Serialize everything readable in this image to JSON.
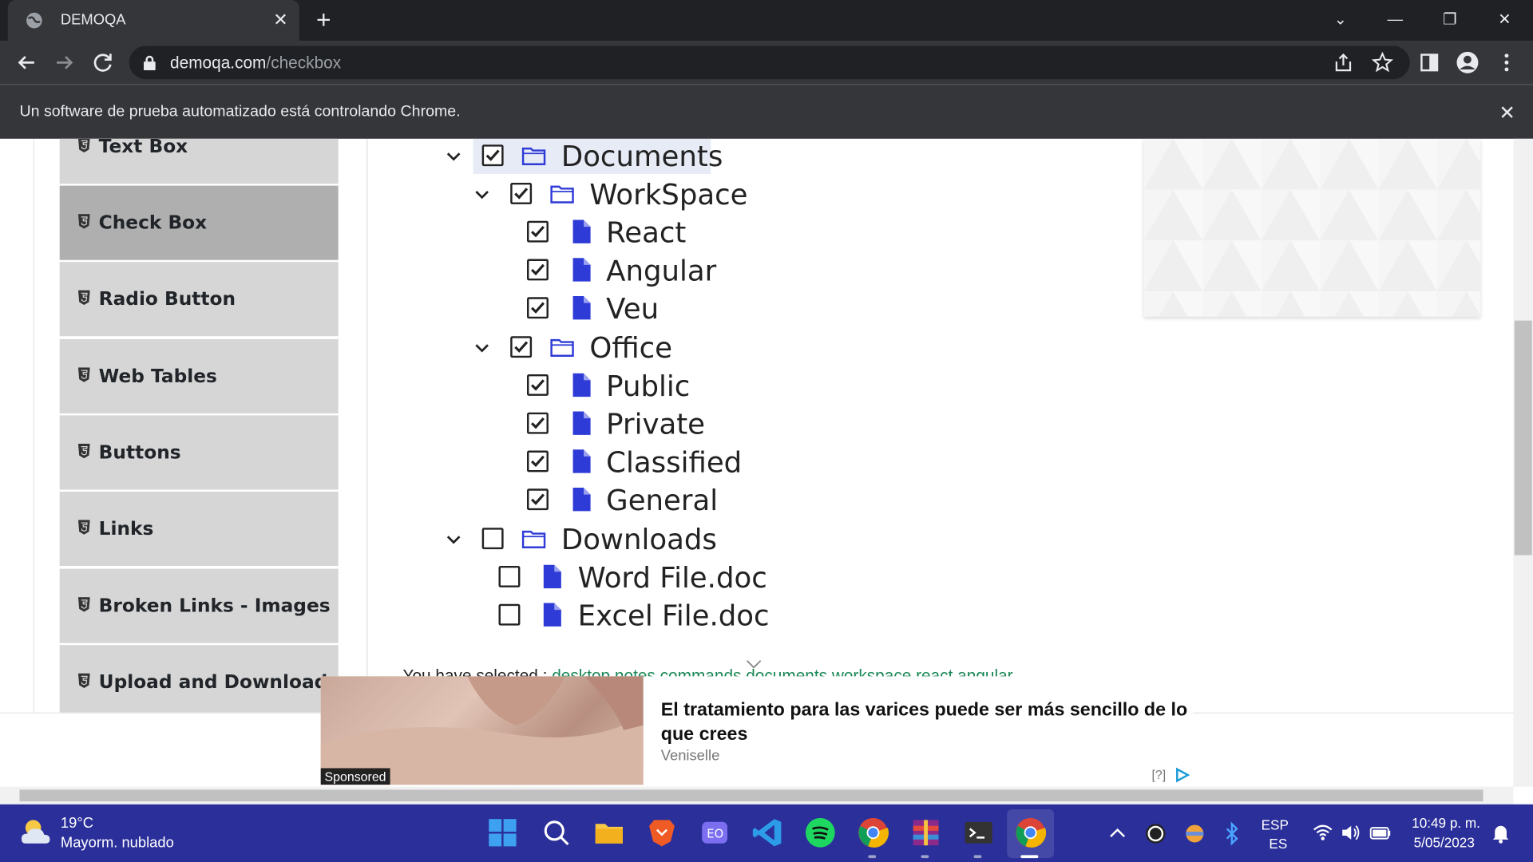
{
  "browser": {
    "tab_title": "DEMOQA",
    "url_host": "demoqa.com",
    "url_path": "/checkbox",
    "infobar_message": "Un software de prueba automatizado está controlando Chrome."
  },
  "sidebar": {
    "items": [
      {
        "label": "Text Box"
      },
      {
        "label": "Check Box"
      },
      {
        "label": "Radio Button"
      },
      {
        "label": "Web Tables"
      },
      {
        "label": "Buttons"
      },
      {
        "label": "Links"
      },
      {
        "label": "Broken Links - Images"
      },
      {
        "label": "Upload and Download"
      }
    ],
    "active_index": 1
  },
  "tree": {
    "nodes": [
      {
        "label": "Documents",
        "checked": true,
        "type": "folder",
        "expanded": true
      },
      {
        "label": "WorkSpace",
        "checked": true,
        "type": "folder",
        "expanded": true
      },
      {
        "label": "React",
        "checked": true,
        "type": "file"
      },
      {
        "label": "Angular",
        "checked": true,
        "type": "file"
      },
      {
        "label": "Veu",
        "checked": true,
        "type": "file"
      },
      {
        "label": "Office",
        "checked": true,
        "type": "folder",
        "expanded": true
      },
      {
        "label": "Public",
        "checked": true,
        "type": "file"
      },
      {
        "label": "Private",
        "checked": true,
        "type": "file"
      },
      {
        "label": "Classified",
        "checked": true,
        "type": "file"
      },
      {
        "label": "General",
        "checked": true,
        "type": "file"
      },
      {
        "label": "Downloads",
        "checked": false,
        "type": "folder",
        "expanded": true
      },
      {
        "label": "Word File.doc",
        "checked": false,
        "type": "file"
      },
      {
        "label": "Excel File.doc",
        "checked": false,
        "type": "file"
      }
    ]
  },
  "result": {
    "prefix": "You have selected :",
    "items": "desktop notes commands documents workspace react angular"
  },
  "ad": {
    "headline": "El tratamiento para las varices puede ser más sencillo de lo que crees",
    "source": "Veniselle",
    "sponsored": "Sponsored",
    "help": "[?]"
  },
  "taskbar": {
    "temp": "19°C",
    "weather": "Mayorm. nublado",
    "lang_top": "ESP",
    "lang_bottom": "ES",
    "time": "10:49 p. m.",
    "date": "5/05/2023"
  },
  "colors": {
    "icon_blue": "#2e3bd6",
    "sidebar_bg": "#d6d6d6",
    "sidebar_active": "#afafaf",
    "taskbar": "#2b2f9a"
  }
}
